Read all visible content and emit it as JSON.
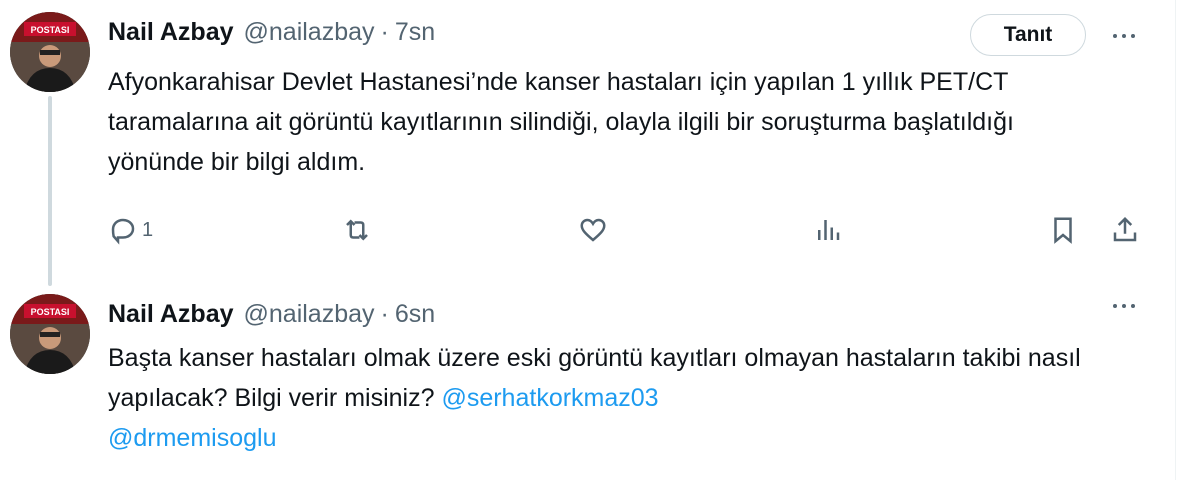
{
  "tweets": [
    {
      "name": "Nail Azbay",
      "handle": "@nailazbay",
      "separator": "·",
      "time": "7sn",
      "follow_label": "Tanıt",
      "text": "Afyonkarahisar Devlet Hastanesi’nde kanser hastaları için yapılan 1 yıllık PET/CT taramalarına ait görüntü kayıtlarının silindiği, olayla ilgili bir soruşturma başlatıldığı yönünde bir bilgi aldım.",
      "reply_count": "1",
      "avatar_text": [
        "POSTASI"
      ]
    },
    {
      "name": "Nail Azbay",
      "handle": "@nailazbay",
      "separator": "·",
      "time": "6sn",
      "text_before": "Başta kanser hastaları olmak üzere eski görüntü kayıtları olmayan hastaların takibi nasıl yapılacak? Bilgi verir misiniz? ",
      "mention1": "@serhatkorkmaz03",
      "mention2": "@drmemisoglu",
      "avatar_text": [
        "POSTASI"
      ]
    }
  ],
  "icons": {
    "reply": "reply-icon",
    "retweet": "retweet-icon",
    "like": "heart-icon",
    "views": "views-icon",
    "bookmark": "bookmark-icon",
    "share": "share-icon",
    "more": "more-icon"
  },
  "colors": {
    "text": "#0f1419",
    "secondary": "#536471",
    "link": "#1d9bf0",
    "thread_line": "#cfd9de"
  }
}
